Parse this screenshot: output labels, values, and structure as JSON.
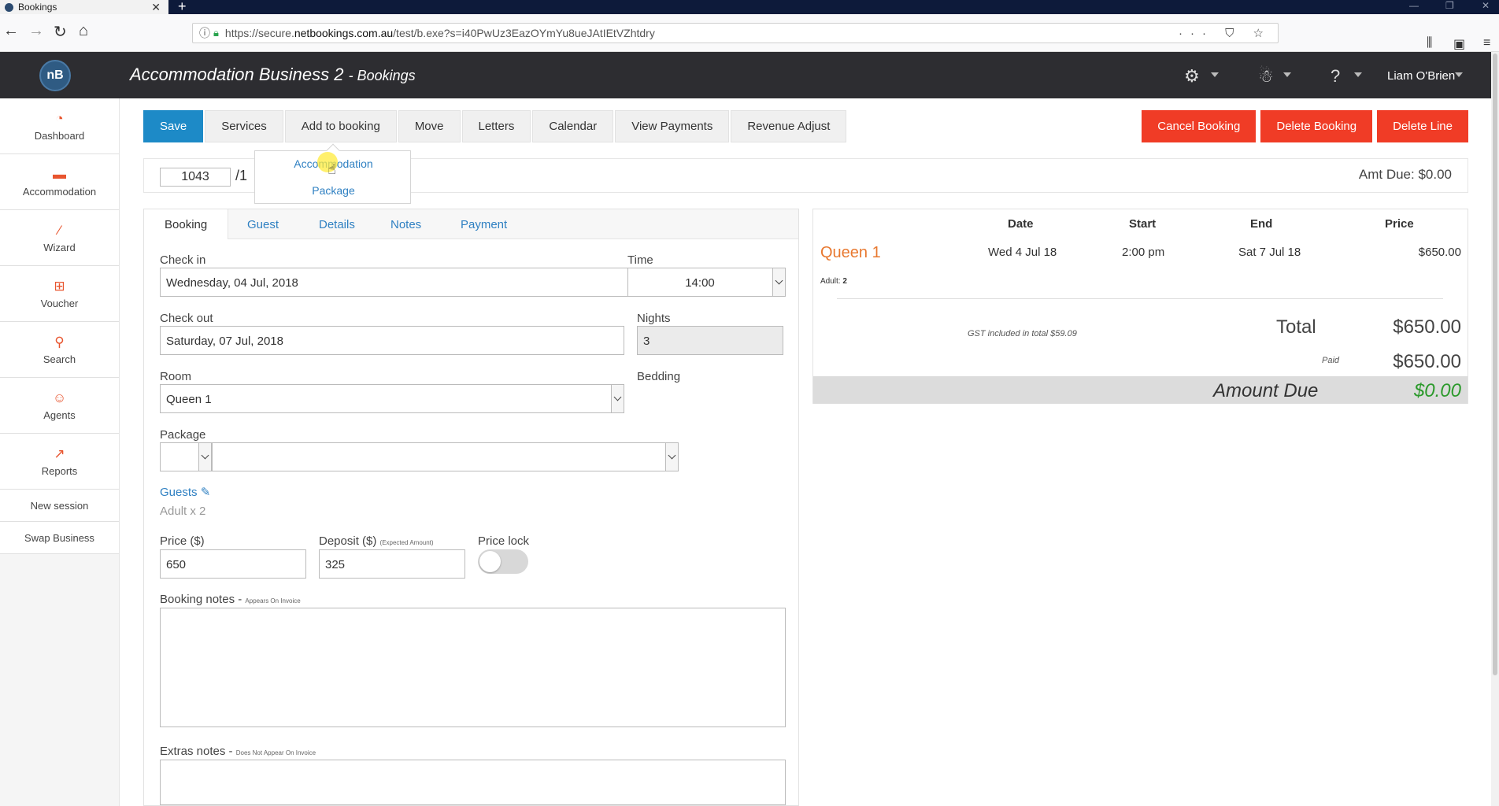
{
  "browser": {
    "tab_title": "Bookings",
    "url_prefix": "https://secure.",
    "url_host": "netbookings.com.au",
    "url_path": "/test/b.exe?s=i40PwUz3EazOYmYu8ueJAtIEtVZhtdry"
  },
  "header": {
    "title": "Accommodation Business 2",
    "subtitle": "- Bookings",
    "user_name": "Liam O'Brien",
    "logo_text": "nB"
  },
  "sidebar": {
    "items": [
      {
        "label": "Dashboard",
        "icon": "dashboard-icon"
      },
      {
        "label": "Accommodation",
        "icon": "bed-icon"
      },
      {
        "label": "Wizard",
        "icon": "wand-icon"
      },
      {
        "label": "Voucher",
        "icon": "gift-icon"
      },
      {
        "label": "Search",
        "icon": "search-icon"
      },
      {
        "label": "Agents",
        "icon": "agent-icon"
      },
      {
        "label": "Reports",
        "icon": "chart-icon"
      }
    ],
    "links": [
      "New session",
      "Swap Business"
    ]
  },
  "toolbar": {
    "save": "Save",
    "services": "Services",
    "add_to_booking": "Add to booking",
    "move": "Move",
    "letters": "Letters",
    "calendar": "Calendar",
    "view_payments": "View Payments",
    "revenue_adjust": "Revenue Adjust",
    "cancel_booking": "Cancel Booking",
    "delete_booking": "Delete Booking",
    "delete_line": "Delete Line"
  },
  "dropdown": {
    "items": [
      "Accommodation",
      "Package"
    ]
  },
  "ref": {
    "booking_number": "1043",
    "suffix": "/1",
    "amt_due": "Amt Due: $0.00"
  },
  "tabs": [
    "Booking",
    "Guest",
    "Details",
    "Notes",
    "Payment"
  ],
  "form": {
    "checkin_label": "Check in",
    "checkin_value": "Wednesday, 04 Jul, 2018",
    "time_label": "Time",
    "time_value": "14:00",
    "checkout_label": "Check out",
    "checkout_value": "Saturday, 07 Jul, 2018",
    "nights_label": "Nights",
    "nights_value": "3",
    "room_label": "Room",
    "room_value": "Queen 1",
    "bedding_label": "Bedding",
    "package_label": "Package",
    "guests_label": "Guests",
    "guests_value": "Adult x 2",
    "price_label": "Price ($)",
    "price_value": "650",
    "deposit_label": "Deposit ($)",
    "deposit_note": "(Expected Amount)",
    "deposit_value": "325",
    "pricelock_label": "Price lock",
    "booking_notes_label": "Booking notes -",
    "booking_notes_note": "Appears On Invoice",
    "extras_notes_label": "Extras notes -",
    "extras_notes_note": "Does Not Appear On Invoice"
  },
  "summary": {
    "headers": {
      "date": "Date",
      "start": "Start",
      "end": "End",
      "price": "Price"
    },
    "room": "Queen 1",
    "date": "Wed 4 Jul 18",
    "start": "2:00 pm",
    "end": "Sat 7 Jul 18",
    "price": "$650.00",
    "adult_label": "Adult:",
    "adult_count": "2",
    "gst": "GST included in total $59.09",
    "total_label": "Total",
    "total_value": "$650.00",
    "paid_label": "Paid",
    "paid_value": "$650.00",
    "amount_due_label": "Amount Due",
    "amount_due_value": "$0.00"
  }
}
